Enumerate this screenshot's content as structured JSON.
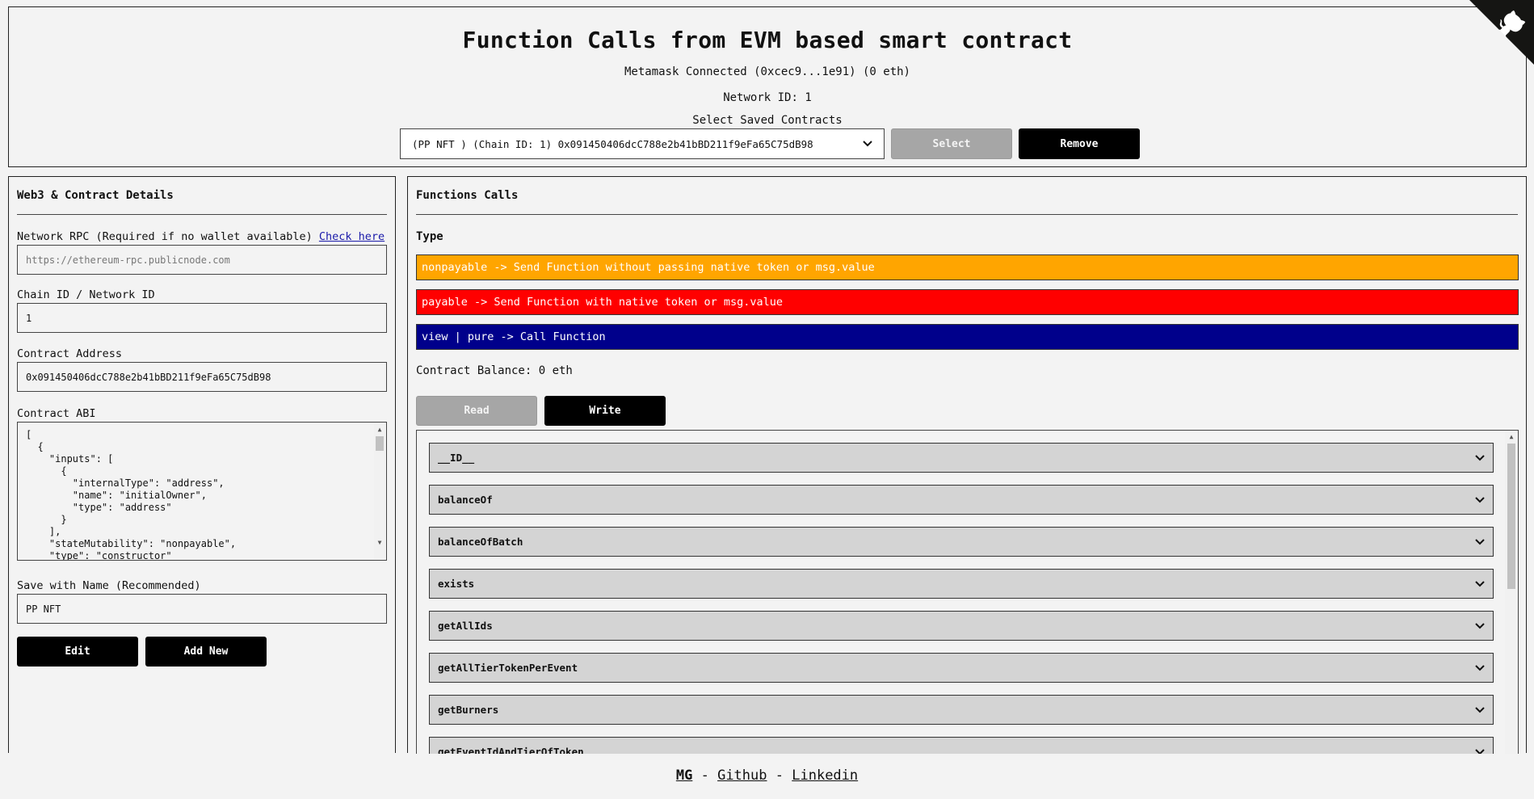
{
  "header": {
    "title": "Function Calls from EVM based smart contract",
    "wallet_status": "Metamask Connected (0xcec9...1e91) (0 eth)",
    "network": "Network ID: 1",
    "select_label": "Select Saved Contracts",
    "selected_contract": "(PP NFT ) (Chain ID: 1) 0x091450406dcC788e2b41bBD211f9eFa65C75dB98",
    "select_button": "Select",
    "remove_button": "Remove"
  },
  "left": {
    "title": "Web3 & Contract Details",
    "rpc_label": "Network RPC (Required if no wallet available)",
    "rpc_link": "Check here ->",
    "rpc_placeholder": "https://ethereum-rpc.publicnode.com",
    "chain_label": "Chain ID / Network ID",
    "chain_value": "1",
    "address_label": "Contract Address",
    "address_value": "0x091450406dcC788e2b41bBD211f9eFa65C75dB98",
    "abi_label": "Contract ABI",
    "abi_text": "[\n  {\n    \"inputs\": [\n      {\n        \"internalType\": \"address\",\n        \"name\": \"initialOwner\",\n        \"type\": \"address\"\n      }\n    ],\n    \"stateMutability\": \"nonpayable\",\n    \"type\": \"constructor\"",
    "save_label": "Save with Name (Recommended)",
    "save_value": "PP NFT",
    "edit_button": "Edit",
    "add_button": "Add New"
  },
  "right": {
    "title": "Functions Calls",
    "type_label": "Type",
    "types": [
      {
        "text": "nonpayable -> Send Function without passing native token or msg.value",
        "color": "#ffa500"
      },
      {
        "text": "payable -> Send Function with native token or msg.value",
        "color": "#ff0000"
      },
      {
        "text": "view | pure -> Call Function",
        "color": "#00008b"
      }
    ],
    "balance": "Contract Balance: 0 eth",
    "read_tab": "Read",
    "write_tab": "Write",
    "functions": [
      "__ID__",
      "balanceOf",
      "balanceOfBatch",
      "exists",
      "getAllIds",
      "getAllTierTokenPerEvent",
      "getBurners",
      "getEventIdAndTierOfToken"
    ]
  },
  "footer": {
    "mg": "MG",
    "github": "Github",
    "linkedin": "Linkedin",
    "sep": "-"
  }
}
